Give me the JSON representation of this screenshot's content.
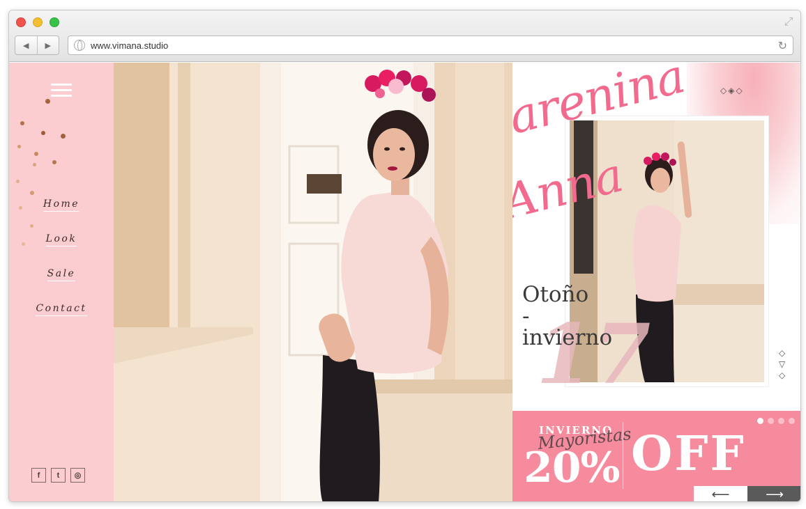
{
  "browser": {
    "url": "www.vimana.studio",
    "icons": {
      "back": "chevron-left-icon",
      "forward": "chevron-right-icon",
      "globe": "globe-icon",
      "reload": "reload-icon",
      "expand": "expand-icon"
    }
  },
  "sidebar": {
    "background": "#fccdd0",
    "nav": [
      {
        "label": "Home"
      },
      {
        "label": "Look"
      },
      {
        "label": "Sale"
      },
      {
        "label": "Contact"
      }
    ],
    "social": [
      {
        "icon": "facebook-icon",
        "glyph": "f"
      },
      {
        "icon": "twitter-icon",
        "glyph": "🐦"
      },
      {
        "icon": "instagram-icon",
        "glyph": "◎"
      }
    ]
  },
  "brand": {
    "line1": "Karenina",
    "line2": "Anna",
    "color": "#f26a8d"
  },
  "collection": {
    "line1": "Otoño",
    "line2": "-",
    "line3": "invierno",
    "year": "17"
  },
  "promo": {
    "background": "#f78b9e",
    "eyebrow": "INVIERNO",
    "script": "Mayoristas",
    "percent": "20%",
    "off": "OFF",
    "slide_count": 4,
    "active_slide": 1
  }
}
